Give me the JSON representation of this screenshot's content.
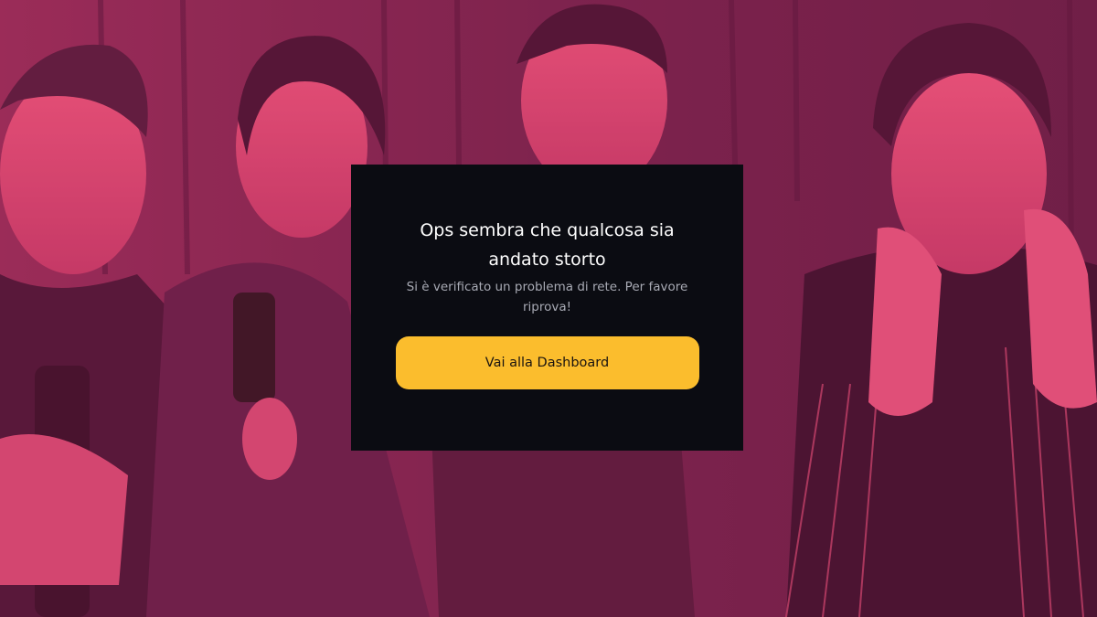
{
  "modal": {
    "title": "Ops sembra che qualcosa sia andato storto",
    "message": "Si è verificato un problema di rete. Per favore riprova!",
    "button_label": "Vai alla Dashboard"
  },
  "colors": {
    "overlay_tint": "#d83a6c",
    "modal_background": "#0b0c12",
    "button_accent": "#fbbd2d"
  }
}
